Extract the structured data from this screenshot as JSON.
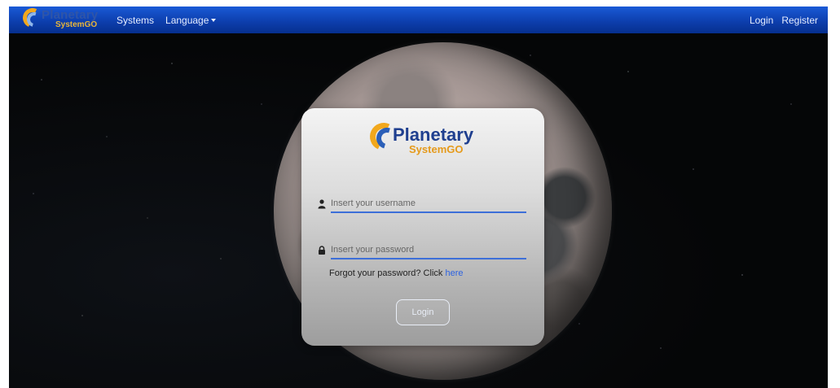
{
  "navbar": {
    "brand_title": "Planetary",
    "brand_subtitle": "SystemGO",
    "links": {
      "systems": "Systems",
      "language": "Language"
    },
    "right": {
      "login": "Login",
      "register": "Register"
    }
  },
  "card": {
    "logo_title": "Planetary",
    "logo_subtitle": "SystemGO",
    "username_placeholder": "Insert your username",
    "password_placeholder": "Insert your password",
    "forgot_text": "Forgot your password? Click",
    "forgot_link": "here",
    "login_button": "Login"
  },
  "icons": {
    "user": "user-icon",
    "lock": "lock-icon",
    "language_dropdown": "chevron-down-icon"
  },
  "colors": {
    "navbar": "#0d3fae",
    "accent": "#3d6fd8",
    "link": "#2d62e0",
    "logo_orange": "#f2a81d"
  }
}
